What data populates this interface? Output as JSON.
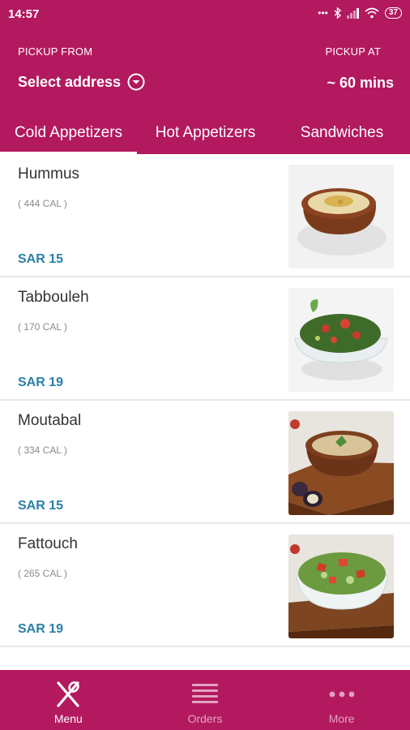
{
  "status_bar": {
    "time": "14:57",
    "dots": "•••",
    "battery": "37"
  },
  "header": {
    "pickup_from_label": "PICKUP FROM",
    "pickup_at_label": "PICKUP AT",
    "address": "Select address",
    "pickup_time": "~ 60 mins"
  },
  "tabs": [
    {
      "label": "Cold Appetizers",
      "active": true
    },
    {
      "label": "Hot Appetizers",
      "active": false
    },
    {
      "label": "Sandwiches",
      "active": false
    }
  ],
  "items": [
    {
      "name": "Hummus",
      "calories": "( 444 CAL )",
      "price": "SAR 15",
      "image": "hummus-image"
    },
    {
      "name": "Tabbouleh",
      "calories": "( 170 CAL )",
      "price": "SAR 19",
      "image": "tabbouleh-image"
    },
    {
      "name": "Moutabal",
      "calories": "( 334 CAL )",
      "price": "SAR 15",
      "image": "moutabal-image"
    },
    {
      "name": "Fattouch",
      "calories": "( 265 CAL )",
      "price": "SAR 19",
      "image": "fattouch-image"
    }
  ],
  "bottom_nav": [
    {
      "label": "Menu",
      "icon": "fork-knife-icon",
      "active": true
    },
    {
      "label": "Orders",
      "icon": "list-icon",
      "active": false
    },
    {
      "label": "More",
      "icon": "more-dots-icon",
      "active": false
    }
  ],
  "colors": {
    "brand": "#b3195f",
    "price": "#2a7fa8"
  }
}
